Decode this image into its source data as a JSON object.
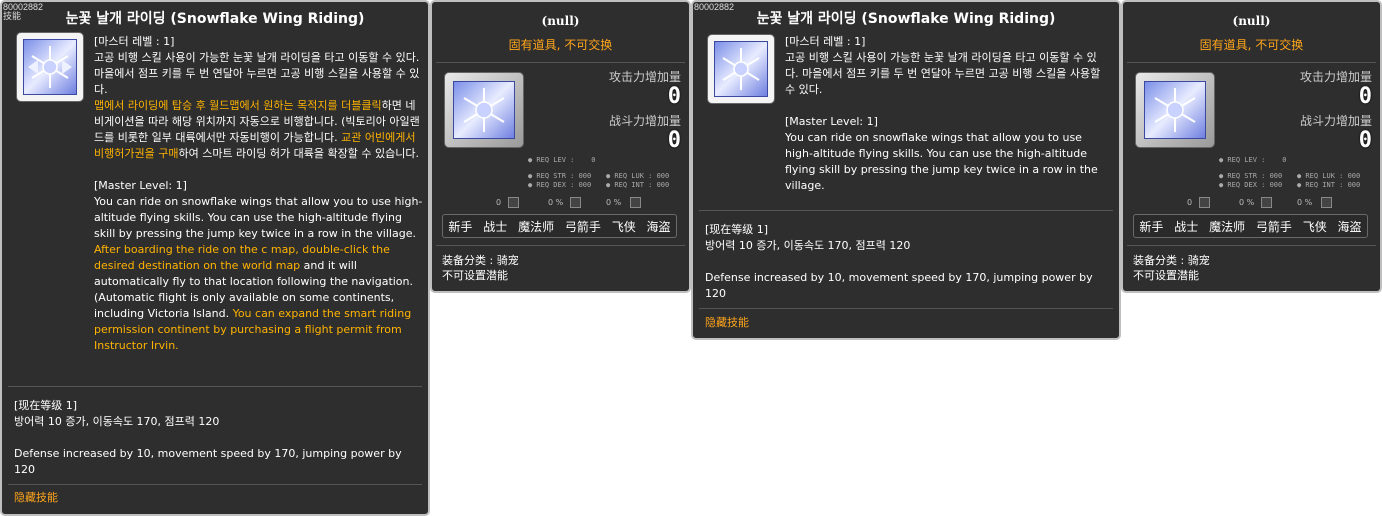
{
  "skill_tooltip": {
    "id": "80002882",
    "id_sub": "技能",
    "title": "눈꽃 날개 라이딩 (Snowflake Wing Riding)",
    "master_level_kr": "[마스터 레벨 : 1]",
    "desc_kr_1": "고공 비행 스킬 사용이 가능한 눈꽃 날개 라이딩을 타고 이동할 수 있다. 마을에서 점프 키를 두 번 연달아 누르면 고공 비행 스킬을 사용할 수 있다.",
    "desc_kr_hl1": "맵에서 라이딩에 탑승 후 월드맵에서 원하는 목적지를 더블클릭",
    "desc_kr_2": "하면 네비게이션을 따라 해당 위치까지 자동으로 비행합니다. (빅토리아 아일랜드를 비롯한 일부 대륙에서만 자동비행이 가능합니다. ",
    "desc_kr_hl2": "교관 어빈에게서 비행허가권을 구매",
    "desc_kr_3": "하여 스마트 라이딩 허가 대륙을 확장할 수 있습니다.",
    "master_level_en": "[Master Level: 1]",
    "desc_en_1": "You can ride on snowflake wings that allow you to use high-altitude flying skills. You can use the high-altitude flying skill by pressing the jump key twice in a row in the village.",
    "desc_en_hl1": "After boarding the ride on the c map, double-click the desired destination on the world map",
    "desc_en_2": " and it will automatically fly to that location following the navigation. (Automatic flight is only available on some continents, including Victoria Island. ",
    "desc_en_hl2": "You can expand the smart riding permission continent by purchasing a flight permit from Instructor Irvin.",
    "current_level": "[现在等级 1]",
    "effect_kr": "방어력 10 증가, 이동속도 170, 점프력 120",
    "effect_en": "Defense increased by 10, movement speed by 170, jumping power by 120",
    "hidden": "隐藏技能"
  },
  "item_tooltip": {
    "title": "(null)",
    "untradable": "固有道具, 不可交换",
    "attack_label": "攻击力增加量",
    "attack_value": "0",
    "combat_label": "战斗力增加量",
    "combat_value": "0",
    "req_lev": "● REQ LEV :    0",
    "req_str": "● REQ STR : 000",
    "req_luk": "● REQ LUK : 000",
    "req_dex": "● REQ DEX : 000",
    "req_int": "● REQ INT : 000",
    "mini_1": "0",
    "mini_2": "0 %",
    "mini_3": "0 %",
    "jobs": [
      "新手",
      "战士",
      "魔法师",
      "弓箭手",
      "飞侠",
      "海盗"
    ],
    "category": "装备分类 : 骑宠",
    "no_potential": "不可设置潜能"
  },
  "skill_tooltip_2": {
    "id": "80002882",
    "title": "눈꽃 날개 라이딩 (Snowflake Wing Riding)",
    "master_level_kr": "[마스터 레벨 : 1]",
    "desc_kr": "고공 비행 스킬 사용이 가능한 눈꽃 날개 라이딩을 타고 이동할 수 있다. 마을에서 점프 키를 두 번 연달아 누르면 고공 비행 스킬을 사용할 수 있다.",
    "master_level_en": "[Master Level: 1]",
    "desc_en": "You can ride on snowflake wings that allow you to use high-altitude flying skills. You can use the high-altitude flying skill by pressing the jump key twice in a row in the village.",
    "current_level": "[现在等级 1]",
    "effect_kr": "방어력 10 증가, 이동속도 170, 점프력 120",
    "effect_en": "Defense increased by 10, movement speed by 170, jumping power by 120",
    "hidden": "隐藏技能"
  },
  "colors": {
    "panel_bg": "#2e2e2e",
    "highlight": "#ffb300",
    "orange": "#ffa51a",
    "border": "#bfbfbf"
  },
  "icons": {
    "skill_icon": "snowflake-wing-icon"
  }
}
